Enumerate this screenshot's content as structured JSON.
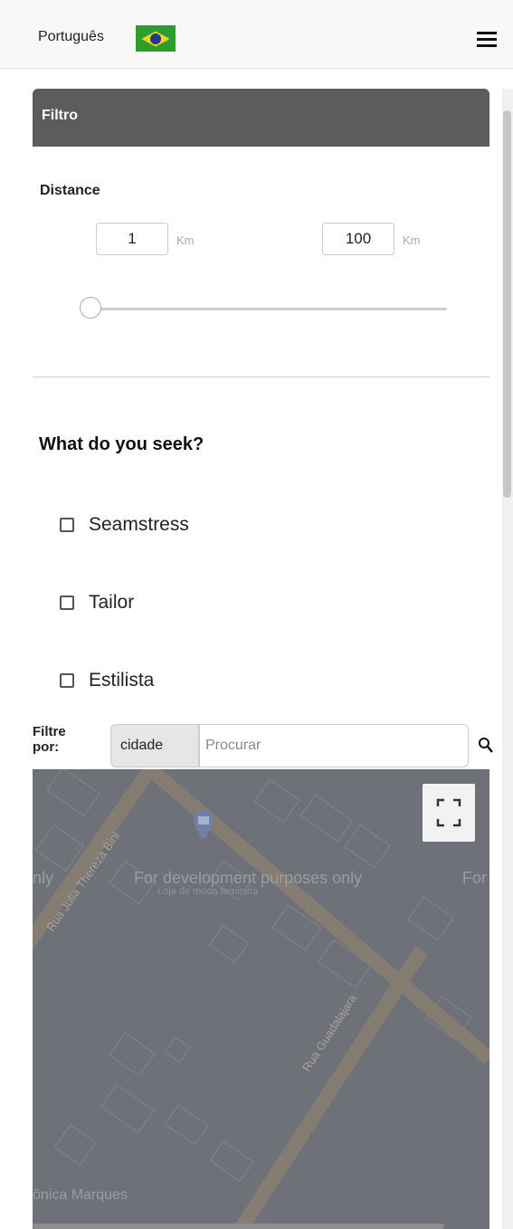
{
  "header": {
    "language": "Português",
    "flag_icon": "brazil-flag-icon",
    "menu_icon": "hamburger-menu-icon"
  },
  "filter": {
    "title": "Filtro",
    "distance_label": "Distance",
    "min_value": "1",
    "max_value": "100",
    "unit": "Km",
    "slider_value": 1
  },
  "seek": {
    "title": "What do you seek?",
    "options": [
      {
        "label": "Seamstress",
        "checked": false
      },
      {
        "label": "Tailor",
        "checked": false
      },
      {
        "label": "Estilista",
        "checked": false
      }
    ]
  },
  "search": {
    "filter_by_label": "Filtre por:",
    "city_button": "cidade",
    "placeholder": "Procurar"
  },
  "map": {
    "watermark": "For development purposes only",
    "watermark_left": "nly",
    "watermark_right": "For",
    "street_1": "Rua Julia Thereza Bini",
    "street_2": "Rua Guadalajara",
    "place_name": "Loja de moda feminina",
    "place_label_partial": "ônica Marques",
    "colors": {
      "background": "#6f7179",
      "road": "#8a7f70"
    }
  }
}
